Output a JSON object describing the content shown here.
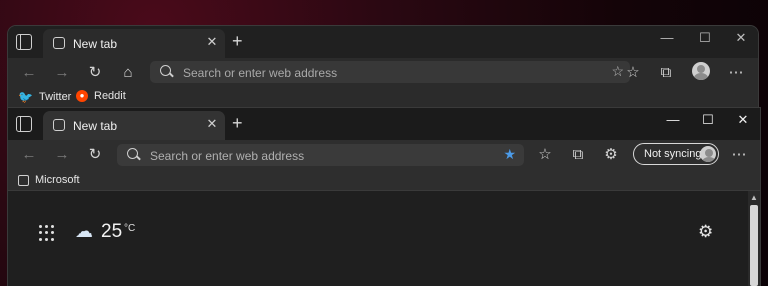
{
  "back_window": {
    "tab": {
      "title": "New tab"
    },
    "address": {
      "placeholder": "Search or enter web address"
    },
    "favorites": [
      {
        "label": "Twitter",
        "icon": "twitter-icon"
      },
      {
        "label": "Reddit",
        "icon": "reddit-icon"
      }
    ]
  },
  "front_window": {
    "tab": {
      "title": "New tab"
    },
    "address": {
      "placeholder": "Search or enter web address"
    },
    "sync": {
      "label": "Not syncing"
    },
    "favorites": [
      {
        "label": "Microsoft",
        "icon": "microsoft-page-icon"
      }
    ],
    "weather": {
      "temperature": "25",
      "unit": "°C"
    }
  },
  "colors": {
    "accent": "#4c9be8",
    "twitter": "#1d9bf0",
    "reddit": "#ff4500"
  }
}
